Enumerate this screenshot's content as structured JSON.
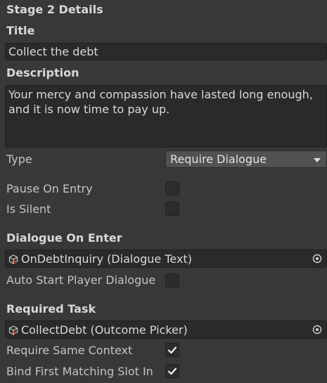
{
  "section_title": "Stage 2 Details",
  "title": {
    "label": "Title",
    "value": "Collect the debt"
  },
  "description": {
    "label": "Description",
    "value": "Your mercy and compassion have lasted long enough, and it is now time to pay up."
  },
  "type": {
    "label": "Type",
    "value": "Require Dialogue"
  },
  "pause_on_entry": {
    "label": "Pause On Entry",
    "checked": false
  },
  "is_silent": {
    "label": "Is Silent",
    "checked": false
  },
  "dialogue_on_enter": {
    "label": "Dialogue On Enter",
    "value": "OnDebtInquiry (Dialogue Text)",
    "icon": "scriptable-object-icon"
  },
  "auto_start_player_dialogue": {
    "label": "Auto Start Player Dialogue",
    "checked": false
  },
  "required_task": {
    "label": "Required Task",
    "value": "CollectDebt (Outcome Picker)",
    "icon": "scriptable-object-icon"
  },
  "require_same_context": {
    "label": "Require Same Context",
    "checked": true
  },
  "bind_first_matching_slot": {
    "label": "Bind First Matching Slot In",
    "checked": true
  },
  "colors": {
    "background": "#383838",
    "field": "#2a2a2a",
    "dropdown": "#515151",
    "text": "#d2d2d2"
  }
}
